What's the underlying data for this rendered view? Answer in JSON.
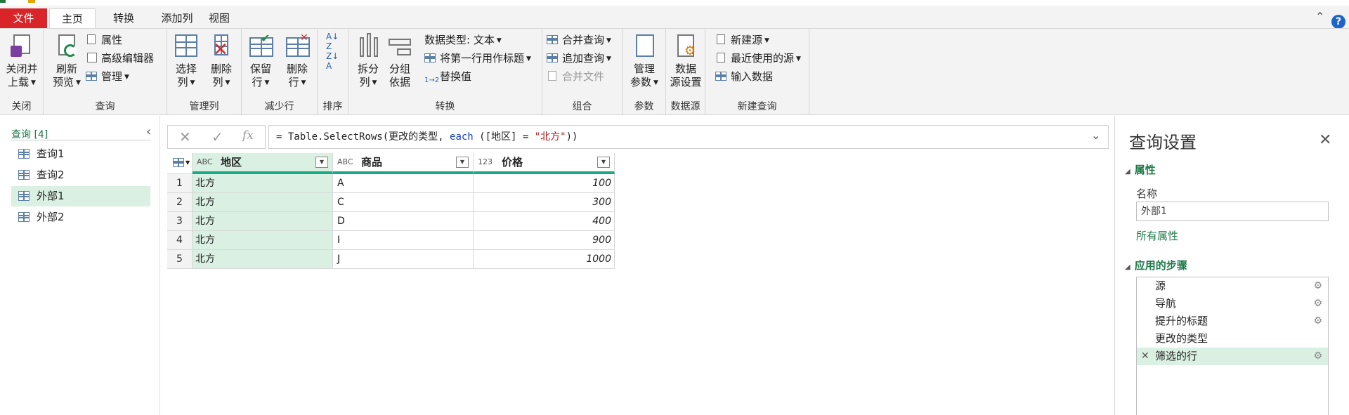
{
  "tabs": {
    "file": "文件",
    "home": "主页",
    "transform": "转换",
    "add_column": "添加列",
    "view": "视图"
  },
  "ribbon": {
    "close": {
      "button": "关闭并\n上载",
      "group": "关闭"
    },
    "query": {
      "refresh": "刷新\n预览",
      "properties": "属性",
      "advanced_editor": "高级编辑器",
      "manage": "管理",
      "group": "查询"
    },
    "manage_columns": {
      "choose": "选择\n列",
      "remove": "删除\n列",
      "group": "管理列"
    },
    "reduce_rows": {
      "keep": "保留\n行",
      "remove": "删除\n行",
      "group": "减少行"
    },
    "sort": {
      "group": "排序"
    },
    "transform": {
      "split": "拆分\n列",
      "group_by": "分组\n依据",
      "data_type": "数据类型: 文本",
      "first_row_header": "将第一行用作标题",
      "replace_values": "替换值",
      "group": "转换"
    },
    "combine": {
      "merge": "合并查询",
      "append": "追加查询",
      "combine_files": "合并文件",
      "group": "组合"
    },
    "parameters": {
      "manage": "管理\n参数",
      "group": "参数"
    },
    "datasource": {
      "settings": "数据\n源设置",
      "group": "数据源"
    },
    "new_query": {
      "new_source": "新建源",
      "recent_sources": "最近使用的源",
      "enter_data": "输入数据",
      "group": "新建查询"
    }
  },
  "queries_pane": {
    "header": "查询 [4]",
    "items": [
      "查询1",
      "查询2",
      "外部1",
      "外部2"
    ],
    "selected": "外部1"
  },
  "formula": {
    "prefix": "= Table.SelectRows(更改的类型, ",
    "keyword": "each",
    "middle": " ([地区] = ",
    "string": "\"北方\"",
    "suffix": "))"
  },
  "grid": {
    "columns": [
      {
        "type": "ABC",
        "name": "地区"
      },
      {
        "type": "ABC",
        "name": "商品"
      },
      {
        "type": "123",
        "name": "价格"
      }
    ],
    "rows": [
      {
        "n": "1",
        "region": "北方",
        "product": "A",
        "price": "100"
      },
      {
        "n": "2",
        "region": "北方",
        "product": "C",
        "price": "300"
      },
      {
        "n": "3",
        "region": "北方",
        "product": "D",
        "price": "400"
      },
      {
        "n": "4",
        "region": "北方",
        "product": "I",
        "price": "900"
      },
      {
        "n": "5",
        "region": "北方",
        "product": "J",
        "price": "1000"
      }
    ]
  },
  "settings": {
    "title": "查询设置",
    "properties_header": "属性",
    "name_label": "名称",
    "name_value": "外部1",
    "all_properties": "所有属性",
    "steps_header": "应用的步骤",
    "steps": [
      "源",
      "导航",
      "提升的标题",
      "更改的类型",
      "筛选的行"
    ]
  },
  "colors": {
    "accent_green": "#1d7a48",
    "file_tab_red": "#d9252a",
    "selection": "#d9f0e2",
    "column_bar": "#1aaa88"
  }
}
